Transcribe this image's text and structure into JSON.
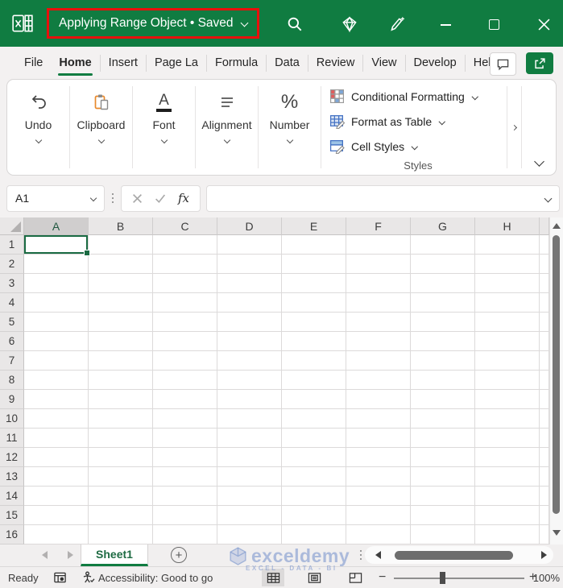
{
  "colors": {
    "excel_green": "#107C41",
    "highlight_red": "#e8100c",
    "sheet_tab_text": "#1e6b43",
    "watermark_blue": "rgba(125,150,205,0.6)"
  },
  "titlebar": {
    "document_title": "Applying Range Object • Saved",
    "icons": [
      "excel-logo-icon",
      "search-icon",
      "gem-icon",
      "sparkle-pen-icon"
    ],
    "window_controls": [
      "minimize-button",
      "maximize-button",
      "close-button"
    ]
  },
  "ribbon_tabs": {
    "items": [
      {
        "label": "File",
        "active": false
      },
      {
        "label": "Home",
        "active": true
      },
      {
        "label": "Insert",
        "active": false
      },
      {
        "label": "Page La",
        "active": false
      },
      {
        "label": "Formula",
        "active": false
      },
      {
        "label": "Data",
        "active": false
      },
      {
        "label": "Review",
        "active": false
      },
      {
        "label": "View",
        "active": false
      },
      {
        "label": "Develop",
        "active": false
      },
      {
        "label": "Help",
        "active": false
      }
    ]
  },
  "ribbon": {
    "groups": [
      {
        "label": "Undo",
        "icon": "undo-icon"
      },
      {
        "label": "Clipboard",
        "icon": "clipboard-icon"
      },
      {
        "label": "Font",
        "icon": "font-icon"
      },
      {
        "label": "Alignment",
        "icon": "alignment-icon"
      },
      {
        "label": "Number",
        "icon": "percent-icon"
      }
    ],
    "styles_group": {
      "items": [
        {
          "label": "Conditional Formatting",
          "icon": "conditional-formatting-icon"
        },
        {
          "label": "Format as Table",
          "icon": "format-as-table-icon"
        },
        {
          "label": "Cell Styles",
          "icon": "cell-styles-icon"
        }
      ],
      "caption": "Styles"
    }
  },
  "formula_bar": {
    "name_box": "A1",
    "fx_label": "fx",
    "value": ""
  },
  "grid": {
    "columns": [
      "A",
      "B",
      "C",
      "D",
      "E",
      "F",
      "G",
      "H"
    ],
    "rows": [
      "1",
      "2",
      "3",
      "4",
      "5",
      "6",
      "7",
      "8",
      "9",
      "10",
      "11",
      "12",
      "13",
      "14",
      "15",
      "16"
    ],
    "selected_cell": "A1",
    "selected_column": "A",
    "selected_row": "1"
  },
  "sheet_bar": {
    "tabs": [
      {
        "label": "Sheet1",
        "active": true
      }
    ],
    "watermark": {
      "text": "exceldemy",
      "subtext": "EXCEL - DATA - BI"
    }
  },
  "status_bar": {
    "mode": "Ready",
    "accessibility": "Accessibility: Good to go",
    "zoom_level": "100%"
  }
}
